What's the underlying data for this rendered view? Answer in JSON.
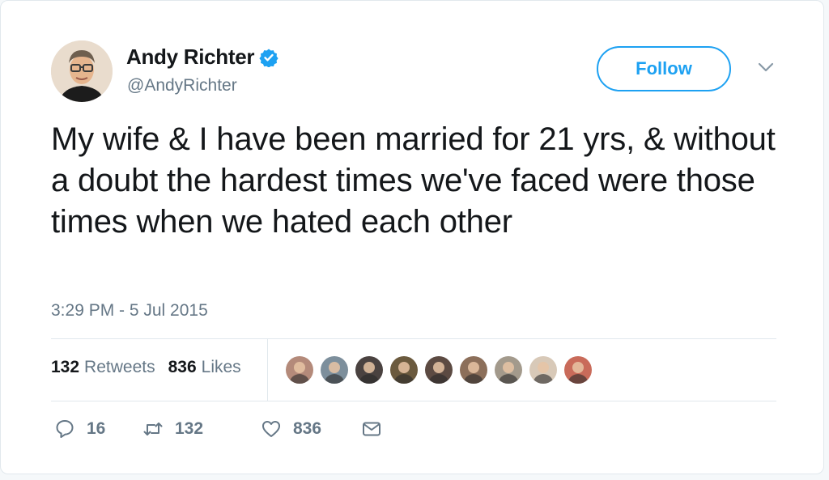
{
  "author": {
    "name": "Andy Richter",
    "handle": "@AndyRichter",
    "verified": true,
    "avatar_icon": "profile-photo-icon"
  },
  "follow_label": "Follow",
  "tweet": {
    "text": "My wife & I have been married for 21 yrs, & without a doubt the hardest times we've faced were those times when we hated each other",
    "timestamp": "3:29 PM - 5 Jul 2015"
  },
  "stats": {
    "retweets_count": "132",
    "retweets_label": "Retweets",
    "likes_count": "836",
    "likes_label": "Likes"
  },
  "likers": [
    {
      "icon": "liker-avatar-icon",
      "color": "#b48a7a"
    },
    {
      "icon": "liker-avatar-icon",
      "color": "#7d8f9c"
    },
    {
      "icon": "liker-avatar-icon",
      "color": "#4a4240"
    },
    {
      "icon": "liker-avatar-icon",
      "color": "#6b5a3e"
    },
    {
      "icon": "liker-avatar-icon",
      "color": "#5c4a42"
    },
    {
      "icon": "liker-avatar-icon",
      "color": "#8c6f5a"
    },
    {
      "icon": "liker-avatar-icon",
      "color": "#a39a8c"
    },
    {
      "icon": "liker-avatar-icon",
      "color": "#d8c9b8"
    },
    {
      "icon": "liker-avatar-icon",
      "color": "#c96b5a"
    }
  ],
  "actions": {
    "reply_count": "16",
    "retweet_count": "132",
    "like_count": "836"
  },
  "colors": {
    "accent": "#1da1f2",
    "muted": "#657786",
    "text": "#14171a"
  }
}
